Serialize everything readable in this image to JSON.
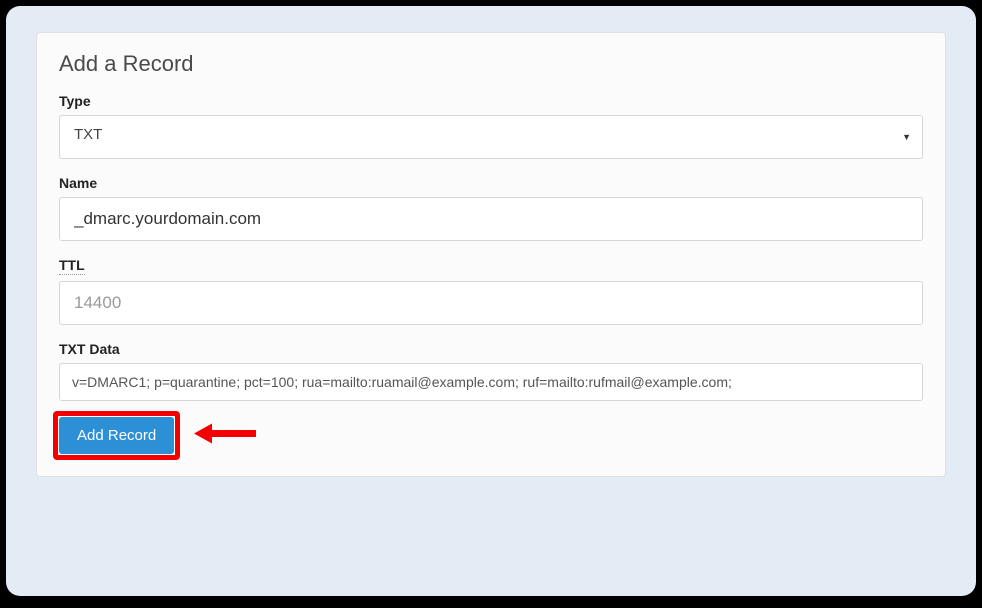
{
  "panel": {
    "title": "Add a Record"
  },
  "form": {
    "type": {
      "label": "Type",
      "value": "TXT"
    },
    "name": {
      "label": "Name",
      "value": "_dmarc.yourdomain.com"
    },
    "ttl": {
      "label": "TTL",
      "value": "14400"
    },
    "txtdata": {
      "label": "TXT Data",
      "value": "v=DMARC1; p=quarantine; pct=100; rua=mailto:ruamail@example.com; ruf=mailto:rufmail@example.com;"
    }
  },
  "actions": {
    "submit_label": "Add Record"
  },
  "annotation": {
    "arrow_color": "#f40000",
    "highlight_color": "#f40000"
  }
}
